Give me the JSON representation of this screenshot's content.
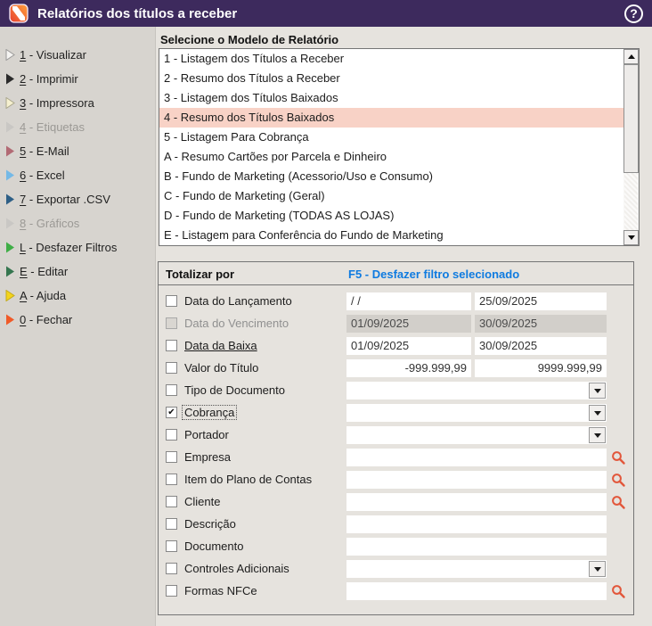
{
  "window": {
    "title": "Relatórios dos títulos a receber",
    "help_icon": "?",
    "titlebar_color": "#3d2a5d"
  },
  "sidebar": {
    "items": [
      {
        "key": "1",
        "text": "Visualizar",
        "arrow": "#f5f4f2",
        "stroke": "#9a9998",
        "disabled": false
      },
      {
        "key": "2",
        "text": "Imprimir",
        "arrow": "#2b2b2b",
        "stroke": "none",
        "disabled": false
      },
      {
        "key": "3",
        "text": "Impressora",
        "arrow": "#f5f0cf",
        "stroke": "#aaa68c",
        "disabled": false
      },
      {
        "key": "4",
        "text": "Etiquetas",
        "arrow": "#c9c7c4",
        "stroke": "none",
        "disabled": true
      },
      {
        "key": "5",
        "text": "E-Mail",
        "arrow": "#b26a74",
        "stroke": "none",
        "disabled": false
      },
      {
        "key": "6",
        "text": "Excel",
        "arrow": "#74b9e6",
        "stroke": "none",
        "disabled": false
      },
      {
        "key": "7",
        "text": "Exportar .CSV",
        "arrow": "#2e5f86",
        "stroke": "none",
        "disabled": false
      },
      {
        "key": "8",
        "text": "Gráficos",
        "arrow": "#c9c7c4",
        "stroke": "none",
        "disabled": true
      },
      {
        "key": "L",
        "text": "Desfazer Filtros",
        "arrow": "#3fae46",
        "stroke": "none",
        "disabled": false
      },
      {
        "key": "E",
        "text": "Editar",
        "arrow": "#35764f",
        "stroke": "none",
        "disabled": false
      },
      {
        "key": "A",
        "text": "Ajuda",
        "arrow": "#f4d41c",
        "stroke": "#c4ab18",
        "disabled": false
      },
      {
        "key": "0",
        "text": "Fechar",
        "arrow": "#f05a28",
        "stroke": "none",
        "disabled": false
      }
    ]
  },
  "report_list": {
    "label": "Selecione o Modelo de Relatório",
    "selected_color": "#f8d2c6",
    "items": [
      {
        "text": "1 - Listagem dos Títulos a Receber",
        "selected": false
      },
      {
        "text": "2 - Resumo dos Títulos a Receber",
        "selected": false
      },
      {
        "text": "3 - Listagem dos Títulos Baixados",
        "selected": false
      },
      {
        "text": "4 - Resumo dos Títulos Baixados",
        "selected": true
      },
      {
        "text": "5 - Listagem Para Cobrança",
        "selected": false
      },
      {
        "text": "A - Resumo Cartões por Parcela e Dinheiro",
        "selected": false
      },
      {
        "text": "B - Fundo de Marketing (Acessorio/Uso e Consumo)",
        "selected": false
      },
      {
        "text": "C - Fundo de Marketing (Geral)",
        "selected": false
      },
      {
        "text": "D - Fundo de Marketing (TODAS AS LOJAS)",
        "selected": false
      },
      {
        "text": "E - Listagem para Conferência do Fundo de Marketing",
        "selected": false
      }
    ]
  },
  "panel": {
    "title": "Totalizar por",
    "action": "F5 - Desfazer filtro selecionado",
    "action_color": "#0f7be0",
    "magnifier_color": "#e2573b",
    "rows": [
      {
        "label": "Data do Lançamento",
        "type": "dates",
        "checked": false,
        "disabled": false,
        "v1": "/ /",
        "v2": "25/09/2025",
        "fields_gray": false
      },
      {
        "label": "Data do Vencimento",
        "type": "dates",
        "checked": false,
        "disabled": true,
        "v1": "01/09/2025",
        "v2": "30/09/2025",
        "fields_gray": true
      },
      {
        "label": "Data da Baixa",
        "type": "dates",
        "checked": false,
        "disabled": false,
        "v1": "01/09/2025",
        "v2": "30/09/2025",
        "fields_gray": false,
        "label_underline": true
      },
      {
        "label": "Valor do Título",
        "type": "amounts",
        "checked": false,
        "disabled": false,
        "v1": "-999.999,99",
        "v2": "9999.999,99"
      },
      {
        "label": "Tipo de Documento",
        "type": "combo",
        "checked": false,
        "disabled": false,
        "value": ""
      },
      {
        "label": "Cobrança",
        "type": "combo",
        "checked": true,
        "disabled": false,
        "value": "",
        "focused": true
      },
      {
        "label": "Portador",
        "type": "combo",
        "checked": false,
        "disabled": false,
        "value": ""
      },
      {
        "label": "Empresa",
        "type": "lookup",
        "checked": false,
        "disabled": false,
        "value": ""
      },
      {
        "label": "Item do Plano de Contas",
        "type": "lookup",
        "checked": false,
        "disabled": false,
        "value": ""
      },
      {
        "label": "Cliente",
        "type": "lookup",
        "checked": false,
        "disabled": false,
        "value": ""
      },
      {
        "label": "Descrição",
        "type": "text",
        "checked": false,
        "disabled": false,
        "value": ""
      },
      {
        "label": "Documento",
        "type": "text",
        "checked": false,
        "disabled": false,
        "value": ""
      },
      {
        "label": "Controles Adicionais",
        "type": "combo",
        "checked": false,
        "disabled": false,
        "value": ""
      },
      {
        "label": "Formas NFCe",
        "type": "lookup",
        "checked": false,
        "disabled": false,
        "value": ""
      }
    ]
  }
}
